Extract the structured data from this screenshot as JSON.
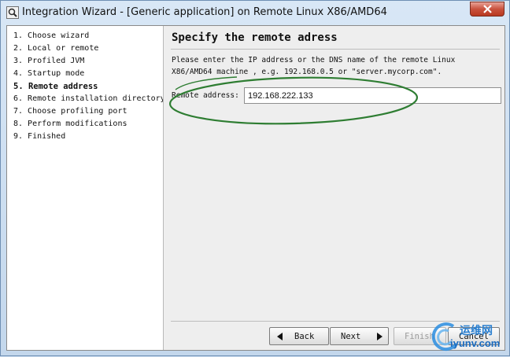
{
  "window": {
    "title": "Integration Wizard - [Generic application] on Remote Linux X86/AMD64",
    "app_icon": "magnifier-icon",
    "close_icon": "close-icon"
  },
  "steps": [
    {
      "label": "1. Choose wizard",
      "current": false
    },
    {
      "label": "2. Local or remote",
      "current": false
    },
    {
      "label": "3. Profiled JVM",
      "current": false
    },
    {
      "label": "4. Startup mode",
      "current": false
    },
    {
      "label": "5. Remote address",
      "current": true
    },
    {
      "label": "6. Remote installation directory",
      "current": false
    },
    {
      "label": "7. Choose profiling port",
      "current": false
    },
    {
      "label": "8. Perform modifications",
      "current": false
    },
    {
      "label": "9. Finished",
      "current": false
    }
  ],
  "content": {
    "heading": "Specify the remote adress",
    "description_line1": "Please enter the IP address or the DNS name of the remote Linux",
    "description_line2": "X86/AMD64 machine , e.g. 192.168.0.5 or \"server.mycorp.com\".",
    "address_label": "Remote address:",
    "address_value": "192.168.222.133"
  },
  "buttons": {
    "back": "Back",
    "next": "Next",
    "finish": "Finish",
    "cancel": "Cancel"
  },
  "watermark": {
    "top": "运维网",
    "bottom": "iyunv.com"
  },
  "colors": {
    "annotation_ellipse": "#2e7d32",
    "close_button": "#c9523d",
    "watermark": "#1b6cc0"
  }
}
